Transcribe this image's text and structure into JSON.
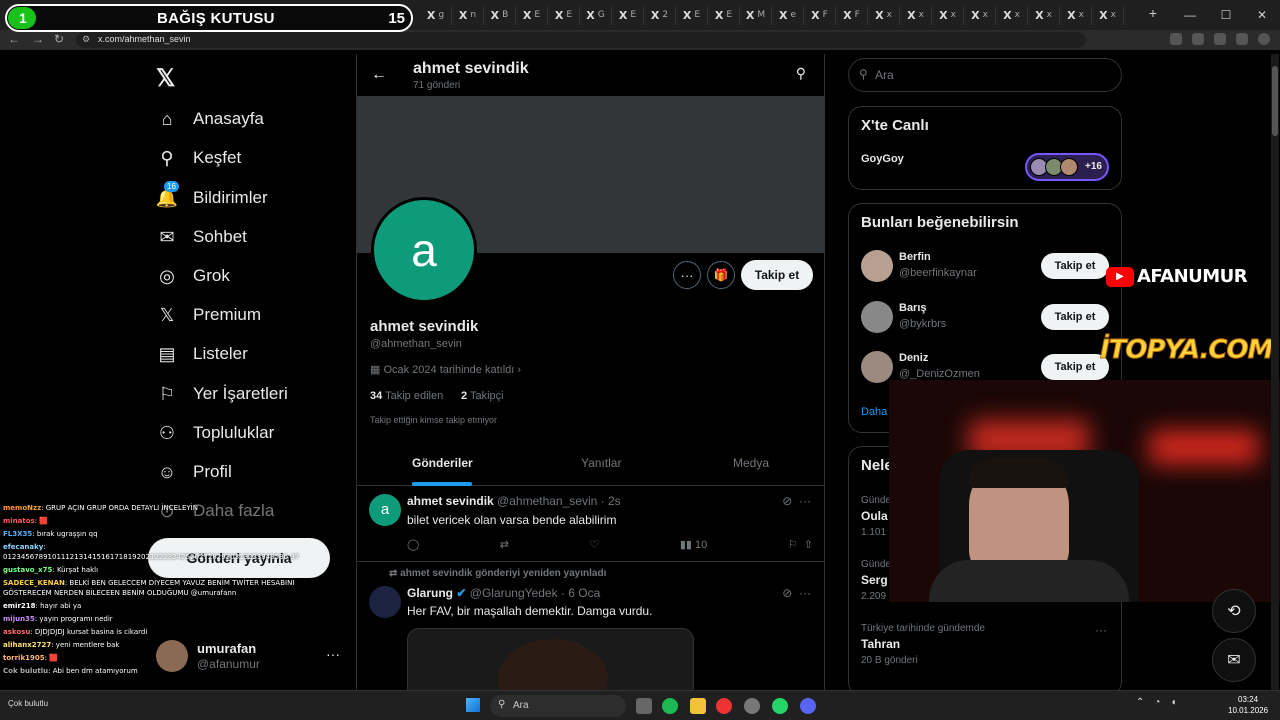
{
  "browser": {
    "url": "x.com/ahmethan_sevin",
    "tabs": [
      "X",
      "X",
      "X",
      "X",
      "X",
      "X",
      "X",
      "X",
      "X",
      "X",
      "X",
      "X",
      "X",
      "X",
      "X",
      "X",
      "X",
      "X",
      "X",
      "X",
      "X",
      "X"
    ],
    "tab_suffixes": [
      "g",
      "n",
      "B",
      "E",
      "E",
      "G",
      "E",
      "2",
      "E",
      "E",
      "M",
      "e",
      "F",
      "F",
      "x",
      "x",
      "x",
      "x",
      "x",
      "x",
      "x",
      "x"
    ]
  },
  "donation": {
    "count": "1",
    "title": "BAĞIŞ KUTUSU",
    "goal": "15"
  },
  "nav": {
    "logo": "𝕏",
    "items": [
      {
        "label": "Anasayfa",
        "icon": "home-icon",
        "glyph": "⌂"
      },
      {
        "label": "Keşfet",
        "icon": "search-icon",
        "glyph": "⚲"
      },
      {
        "label": "Bildirimler",
        "icon": "bell-icon",
        "glyph": "🔔"
      },
      {
        "label": "Sohbet",
        "icon": "mail-icon",
        "glyph": "✉"
      },
      {
        "label": "Grok",
        "icon": "grok-icon",
        "glyph": "◎"
      },
      {
        "label": "Premium",
        "icon": "x-premium-icon",
        "glyph": "𝕏"
      },
      {
        "label": "Listeler",
        "icon": "list-icon",
        "glyph": "▤"
      },
      {
        "label": "Yer İşaretleri",
        "icon": "bookmark-icon",
        "glyph": "⚐"
      },
      {
        "label": "Topluluklar",
        "icon": "communities-icon",
        "glyph": "⚇"
      },
      {
        "label": "Profil",
        "icon": "profile-icon",
        "glyph": "☺"
      },
      {
        "label": "Daha fazla",
        "icon": "more-circle-icon",
        "glyph": "⊙"
      }
    ],
    "notif_count": "16",
    "post_button": "Gönderi yayınla",
    "account": {
      "name": "umurafan",
      "handle": "@afanumur",
      "more": "···"
    }
  },
  "chat": [
    {
      "user": "memoNzz",
      "color": "#ff9d2e",
      "msg": ": GRUP AÇIN GRUP ORDA DETAYLI İNCELEYİN"
    },
    {
      "user": "minatos",
      "color": "#ff5a5a",
      "msg": ": 🟥"
    },
    {
      "user": "FL3X35",
      "color": "#5ab4ff",
      "msg": ": bırak ugraşşın qq"
    },
    {
      "user": "efecanaky",
      "color": "#8fd3ff",
      "msg": ": 0123456789101112131415161718192021222324252627282930313233343536 37"
    },
    {
      "user": "gustavo_x75",
      "color": "#7cff8a",
      "msg": ": Kürşat haklı"
    },
    {
      "user": "SADECE_KENAN",
      "color": "#ffcf3a",
      "msg": ": BELKİ BEN GELECCEM DİYECEM YAVUZ BENİM TWİTER HESABINI GÖSTERECEM NERDEN BİLECEEN BENİM OLDUĞUMU @umurafann"
    },
    {
      "user": "emir218",
      "color": "#ffffff",
      "msg": ": hayır abi ya"
    },
    {
      "user": "mijun35",
      "color": "#c88cff",
      "msg": ": yayın programı nedir"
    },
    {
      "user": "askosu",
      "color": "#ff6a6a",
      "msg": ": DJDJDJDJ kursat basina is cikardi"
    },
    {
      "user": "alihanx2727",
      "color": "#ffe066",
      "msg": ": yeni mentlere bak"
    },
    {
      "user": "torrik1905",
      "color": "#ffb86b",
      "msg": ": 🟥"
    },
    {
      "user": "Cok bulutlu",
      "color": "#aaaaaa",
      "msg": ": Abi ben dm atamıyorum"
    }
  ],
  "profile": {
    "header_name": "ahmet sevindik",
    "post_count": "71 gönderi",
    "avatar_letter": "a",
    "avatar_color": "#0d9b7a",
    "more": "···",
    "follow": "Takip et",
    "name": "ahmet sevindik",
    "handle": "@ahmethan_sevin",
    "joined": "Ocak 2024 tarihinde katıldı",
    "following_count": "34",
    "following_label": "Takip edilen",
    "followers_count": "2",
    "followers_label": "Takipçi",
    "note": "Takip ettiğin kimse takip etmiyor",
    "tabs": [
      "Gönderiler",
      "Yanıtlar",
      "Medya"
    ]
  },
  "posts": [
    {
      "name": "ahmet sevindik",
      "meta": "@ahmethan_sevin · 2s",
      "text": "bilet vericek olan varsa bende alabilirim",
      "views": "10"
    },
    {
      "repost_label": "ahmet sevindik gönderiyi yeniden yayınladı",
      "name": "Glarung",
      "meta": "@GlarungYedek · 6 Oca",
      "text": "Her FAV, bir maşallah demektir. Damga vurdu."
    }
  ],
  "right": {
    "search_placeholder": "Ara",
    "live_title": "X'te Canlı",
    "live_name": "GoyGoy",
    "live_more": "+16",
    "suggest_title": "Bunları beğenebilirsin",
    "suggestions": [
      {
        "name": "Berfin",
        "handle": "@beerfinkaynar",
        "btn": "Takip et"
      },
      {
        "name": "Barış",
        "handle": "@bykrbrs",
        "btn": "Takip et"
      },
      {
        "name": "Deniz",
        "handle": "@_DenizOzmen",
        "btn": "Takip et"
      }
    ],
    "more_link": "Daha",
    "trends_title": "Neler",
    "trends": [
      {
        "cat": "Günde",
        "name": "Oula",
        "count": "1.101"
      },
      {
        "cat": "Günde",
        "name": "Serg",
        "count": "2.209"
      },
      {
        "cat": "Türkiye tarihinde gündemde",
        "name": "Tahran",
        "count": "20 B gönderi"
      }
    ]
  },
  "overlay": {
    "yt_channel": "AFANUMUR",
    "sponsor": "İTOPYA.COM"
  },
  "taskbar": {
    "search": "Ara",
    "time": "03:24",
    "date": "10.01.2026",
    "weather": "Çok bulutlu"
  }
}
